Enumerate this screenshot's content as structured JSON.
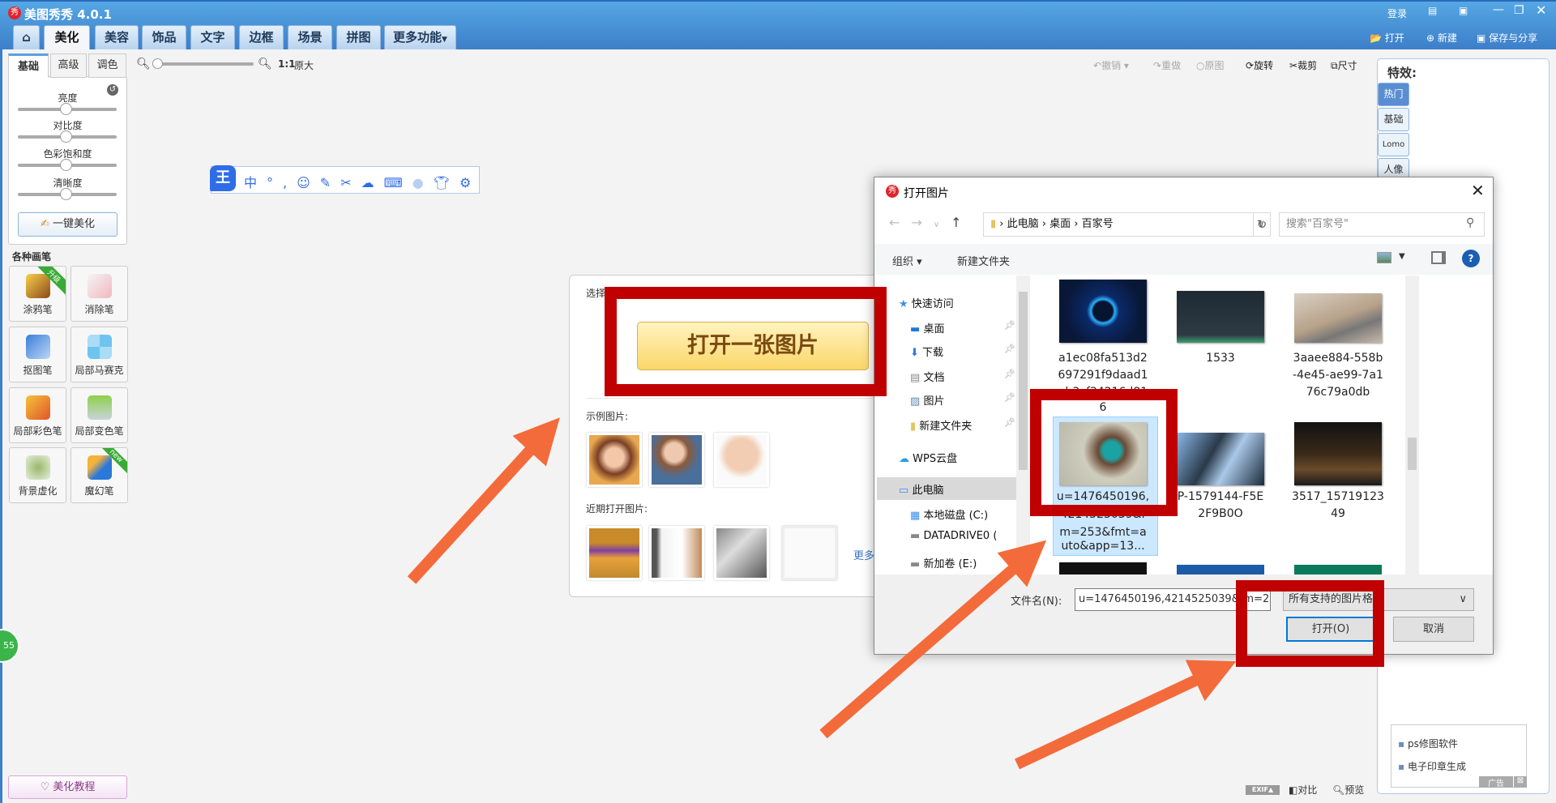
{
  "app": {
    "title": "美图秀秀 4.0.1",
    "login": "登录",
    "open": "打开",
    "new": "新建",
    "save_share": "保存与分享"
  },
  "tabs": [
    "美化",
    "美容",
    "饰品",
    "文字",
    "边框",
    "场景",
    "拼图",
    "更多功能"
  ],
  "zoom": {
    "ratio": "1:1",
    "original": "原大"
  },
  "toolbar": {
    "undo": "撤销",
    "redo": "重做",
    "original": "原图",
    "rotate": "旋转",
    "crop": "裁剪",
    "size": "尺寸"
  },
  "left": {
    "subtabs": [
      "基础",
      "高级",
      "调色"
    ],
    "sliders": [
      "亮度",
      "对比度",
      "色彩饱和度",
      "清晰度"
    ],
    "auto_button": "一键美化",
    "brushes_title": "各种画笔",
    "tools": [
      {
        "label": "涂鸦笔",
        "badge": "升级"
      },
      {
        "label": "消除笔"
      },
      {
        "label": "抠图笔"
      },
      {
        "label": "局部马赛克"
      },
      {
        "label": "局部彩色笔"
      },
      {
        "label": "局部变色笔"
      },
      {
        "label": "背景虚化"
      },
      {
        "label": "魔幻笔",
        "badge": "new"
      }
    ],
    "tutorial": "美化教程",
    "float_badge": "55"
  },
  "center": {
    "prompt": "选择你要编辑的图片",
    "open_button": "打开一张图片",
    "samples_title": "示例图片:",
    "recent_title": "近期打开图片:",
    "more": "更多"
  },
  "right": {
    "title": "特效:",
    "tabs": [
      "热门",
      "基础",
      "Lomo",
      "人像"
    ],
    "ads": [
      "ps修图软件",
      "电子印章生成"
    ],
    "ad_label": "广告"
  },
  "status": {
    "exif": "EXIF",
    "compare": "对比",
    "preview": "预览"
  },
  "dialog": {
    "title": "打开图片",
    "path": [
      "此电脑",
      "桌面",
      "百家号"
    ],
    "search_placeholder": "搜索\"百家号\"",
    "organize": "组织",
    "new_folder": "新建文件夹",
    "nav": [
      "快速访问",
      "桌面",
      "下载",
      "文档",
      "图片",
      "新建文件夹",
      "WPS云盘",
      "此电脑",
      "本地磁盘 (C:)",
      "DATADRIVE0 (D",
      "新加卷 (E:)"
    ],
    "files": [
      [
        "a1ec08fa513d2",
        "697291f9daad1",
        "eb3cf34216d81",
        "6"
      ],
      [
        "1533"
      ],
      [
        "3aaee884-558b",
        "-4e45-ae99-7a1",
        "76c79a0db"
      ],
      [
        "u=1476450196,",
        "4214525039&f",
        "m=253&fmt=a",
        "uto&app=13..."
      ],
      [
        "P-1579144-F5E",
        "2F9B0O"
      ],
      [
        "3517_15719123",
        "49"
      ]
    ],
    "filename_label": "文件名(N):",
    "filename_value": "u=1476450196,4214525039&fm=253&fmt=auto&app=13",
    "filter": "所有支持的图片格式",
    "open": "打开(O)",
    "cancel": "取消"
  },
  "colors": {
    "accent": "#3d7fc9",
    "annotation": "#c00000",
    "arrow": "#f36b3b"
  }
}
